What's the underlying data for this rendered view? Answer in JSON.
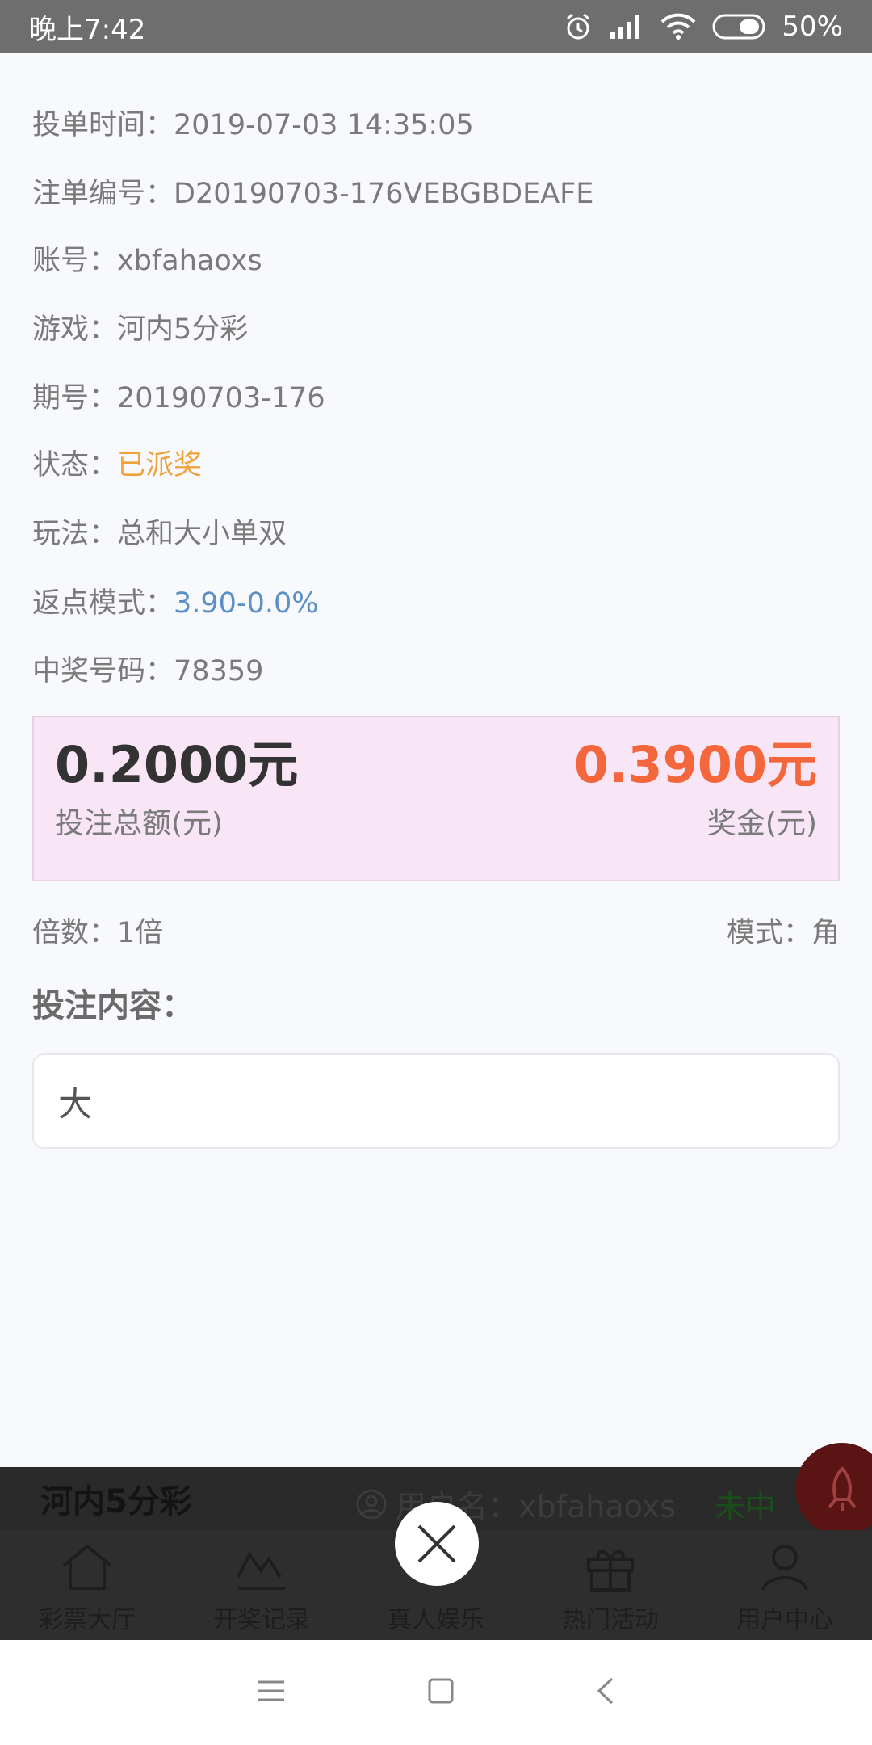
{
  "status_bar": {
    "time": "晚上7:42",
    "battery": "50%"
  },
  "details": [
    {
      "label": "投单时间：",
      "value": "2019-07-03 14:35:05"
    },
    {
      "label": "注单编号：",
      "value": "D20190703-176VEBGBDEAFE"
    },
    {
      "label": "账号：",
      "value": "xbfahaoxs"
    },
    {
      "label": "游戏：",
      "value": "河内5分彩"
    },
    {
      "label": "期号：",
      "value": "20190703-176"
    },
    {
      "label": "状态：",
      "value": "已派奖"
    },
    {
      "label": "玩法：",
      "value": "总和大小单双"
    },
    {
      "label": "返点模式：",
      "value": "3.90-0.0%"
    },
    {
      "label": "中奖号码：",
      "value": "78359"
    }
  ],
  "amounts": {
    "bet_total": "0.2000元",
    "bet_total_label": "投注总额(元)",
    "prize": "0.3900元",
    "prize_label": "奖金(元)"
  },
  "multiplier": "倍数：1倍",
  "mode": "模式：角",
  "content_title": "投注内容：",
  "content_value": "大",
  "background": {
    "title": "河内5分彩",
    "user": "用户名：xbfahaoxs",
    "status": "未中",
    "tabs": [
      "彩票大厅",
      "开奖记录",
      "真人娱乐",
      "热门活动",
      "用户中心"
    ]
  },
  "colors": {
    "status_orange": "#f0a23a",
    "rebate_blue": "#5b8fc7",
    "prize_red": "#f4663c",
    "amount_bg": "#f8e6f6"
  }
}
